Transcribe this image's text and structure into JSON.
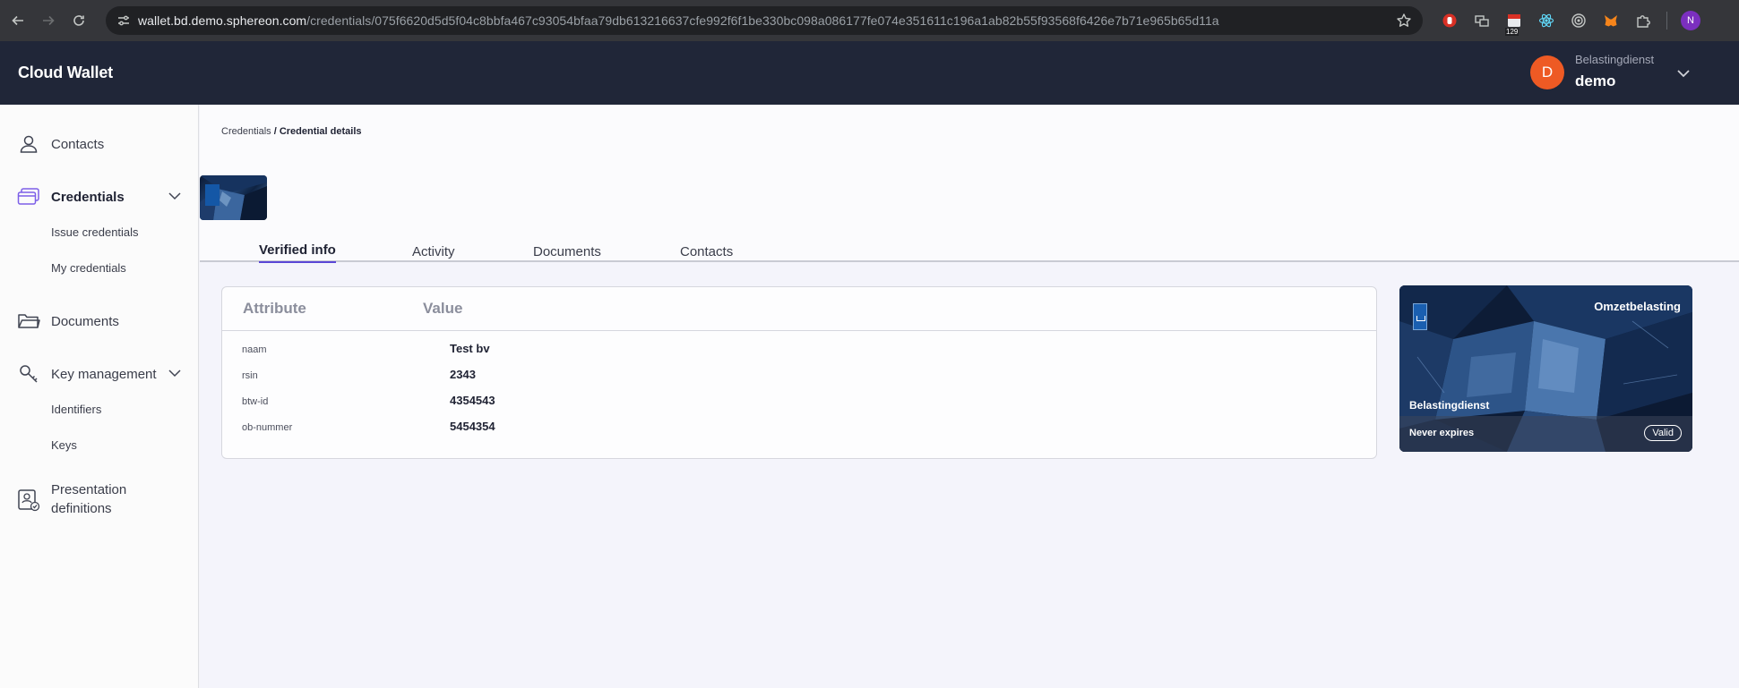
{
  "browser": {
    "url_host": "wallet.bd.demo.sphereon.com",
    "url_path": "/credentials/075f6620d5d5f04c8bbfa467c93054bfaa79db613216637cfe992f6f1be330bc098a086177fe074e351611c196a1ab82b55f93568f6426e7b71e965b65d11a",
    "ext_badge": "129",
    "profile_initial": "N"
  },
  "header": {
    "app_title": "Cloud Wallet",
    "user_initial": "D",
    "user_org": "Belastingdienst",
    "user_name": "demo"
  },
  "sidebar": {
    "contacts": "Contacts",
    "credentials": "Credentials",
    "issue_credentials": "Issue credentials",
    "my_credentials": "My credentials",
    "documents": "Documents",
    "key_management": "Key management",
    "identifiers": "Identifiers",
    "keys": "Keys",
    "presentation_line1": "Presentation",
    "presentation_line2": "definitions"
  },
  "breadcrumb": {
    "parent": "Credentials",
    "current": "/ Credential details"
  },
  "tabs": {
    "verified_info": "Verified info",
    "activity": "Activity",
    "documents": "Documents",
    "contacts": "Contacts"
  },
  "attributes": {
    "header_attribute": "Attribute",
    "header_value": "Value",
    "rows": [
      {
        "key": "naam",
        "value": "Test bv"
      },
      {
        "key": "rsin",
        "value": "2343"
      },
      {
        "key": "btw-id",
        "value": "4354543"
      },
      {
        "key": "ob-nummer",
        "value": "5454354"
      }
    ]
  },
  "credential_card": {
    "title": "Omzetbelasting",
    "issuer": "Belastingdienst",
    "expiry": "Never expires",
    "status": "Valid"
  }
}
